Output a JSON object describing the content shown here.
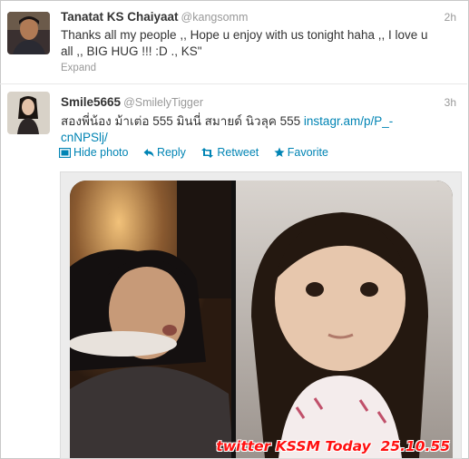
{
  "tweets": [
    {
      "name": "Tanatat KS Chaiyaat",
      "handle": "@kangsomm",
      "time": "2h",
      "text_line1": "Thanks all my people ,, Hope u enjoy with us tonight haha ,, I love u",
      "text_line2": "all ,, BIG HUG !!! :D ., KS\"",
      "expand_label": "Expand"
    },
    {
      "name": "Smile5665",
      "handle": "@SmilelyTigger",
      "time": "3h",
      "text_line1": "สองพี่น้อง ม้าเต่อ 555 มินนี่ สมายด์ นิวลุค 555",
      "link_part1": "instagr.am/p/P_-",
      "link_part2": "cnNPSlj/",
      "actions": {
        "hide_photo": "Hide photo",
        "reply": "Reply",
        "retweet": "Retweet",
        "favorite": "Favorite"
      },
      "icons": [
        "photo-icon",
        "reply-icon",
        "retweet-icon",
        "favorite-icon"
      ]
    }
  ],
  "watermark": "twitter KSSM Today  25.10.55",
  "colors": {
    "link": "#0084b4",
    "watermark": "#ff1010",
    "meta": "#999999"
  }
}
